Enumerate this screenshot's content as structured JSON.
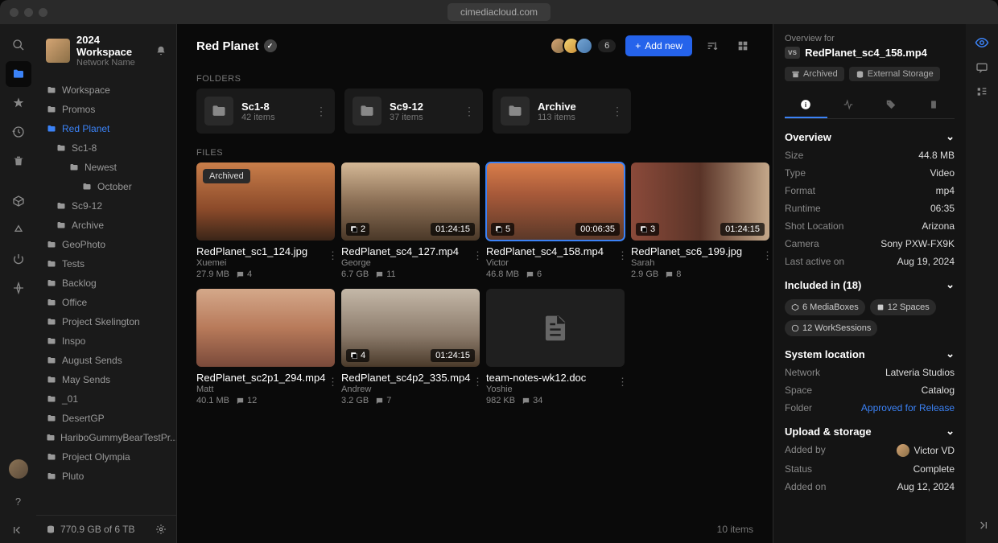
{
  "url": "cimediacloud.com",
  "workspace": {
    "title": "2024 Workspace",
    "subtitle": "Network Name"
  },
  "tree": [
    {
      "label": "Workspace",
      "icon": "folder",
      "indent": 0
    },
    {
      "label": "Promos",
      "icon": "folder",
      "indent": 0
    },
    {
      "label": "Red Planet",
      "icon": "folder-open",
      "indent": 0,
      "active": true
    },
    {
      "label": "Sc1-8",
      "icon": "folder",
      "indent": 1
    },
    {
      "label": "Newest",
      "icon": "folder",
      "indent": 2
    },
    {
      "label": "October",
      "icon": "folder",
      "indent": 3
    },
    {
      "label": "Sc9-12",
      "icon": "folder",
      "indent": 1
    },
    {
      "label": "Archive",
      "icon": "folder",
      "indent": 1
    },
    {
      "label": "GeoPhoto",
      "icon": "folder",
      "indent": 0
    },
    {
      "label": "Tests",
      "icon": "folder",
      "indent": 0
    },
    {
      "label": "Backlog",
      "icon": "folder",
      "indent": 0
    },
    {
      "label": "Office",
      "icon": "folder",
      "indent": 0
    },
    {
      "label": "Project Skelington",
      "icon": "folder",
      "indent": 0
    },
    {
      "label": "Inspo",
      "icon": "folder",
      "indent": 0
    },
    {
      "label": "August Sends",
      "icon": "folder",
      "indent": 0
    },
    {
      "label": "May Sends",
      "icon": "folder",
      "indent": 0
    },
    {
      "label": "_01",
      "icon": "folder",
      "indent": 0
    },
    {
      "label": "DesertGP",
      "icon": "folder",
      "indent": 0
    },
    {
      "label": "HariboGummyBearTestPr...",
      "icon": "folder",
      "indent": 0
    },
    {
      "label": "Project Olympia",
      "icon": "folder",
      "indent": 0
    },
    {
      "label": "Pluto",
      "icon": "folder",
      "indent": 0
    }
  ],
  "storage": "770.9 GB of 6 TB",
  "breadcrumb": "Red Planet",
  "avatar_count": "6",
  "add_btn": "Add new",
  "section_folders": "FOLDERS",
  "section_files": "FILES",
  "folders": [
    {
      "name": "Sc1-8",
      "count": "42 items"
    },
    {
      "name": "Sc9-12",
      "count": "37 items"
    },
    {
      "name": "Archive",
      "count": "113 items"
    }
  ],
  "files": [
    {
      "name": "RedPlanet_sc1_124.jpg",
      "author": "Xuemei",
      "size": "27.9 MB",
      "comments": "4",
      "archived": true,
      "t": "t1"
    },
    {
      "name": "RedPlanet_sc4_127.mp4",
      "author": "George",
      "size": "6.7 GB",
      "comments": "11",
      "bl": "2",
      "br": "01:24:15",
      "t": "t2"
    },
    {
      "name": "RedPlanet_sc4_158.mp4",
      "author": "Victor",
      "size": "46.8 MB",
      "comments": "6",
      "bl": "5",
      "br": "00:06:35",
      "selected": true,
      "t": "t3"
    },
    {
      "name": "RedPlanet_sc6_199.jpg",
      "author": "Sarah",
      "size": "2.9 GB",
      "comments": "8",
      "bl": "3",
      "br": "01:24:15",
      "t": "t4"
    },
    {
      "name": "RedPlanet_sc2p1_294.mp4",
      "author": "Matt",
      "size": "40.1 MB",
      "comments": "12",
      "t": "t5"
    },
    {
      "name": "RedPlanet_sc4p2_335.mp4",
      "author": "Andrew",
      "size": "3.2 GB",
      "comments": "7",
      "bl": "4",
      "br": "01:24:15",
      "t": "t6"
    },
    {
      "name": "team-notes-wk12.doc",
      "author": "Yoshie",
      "size": "982 KB",
      "comments": "34",
      "doc": true
    }
  ],
  "footer_count": "10 items",
  "archived_label": "Archived",
  "details": {
    "overview_for": "Overview for",
    "vs": "vs",
    "title": "RedPlanet_sc4_158.mp4",
    "badges": [
      {
        "icon": "archive",
        "label": "Archived"
      },
      {
        "icon": "storage",
        "label": "External Storage"
      }
    ],
    "overview_h": "Overview",
    "rows": [
      {
        "k": "Size",
        "v": "44.8 MB"
      },
      {
        "k": "Type",
        "v": "Video"
      },
      {
        "k": "Format",
        "v": "mp4"
      },
      {
        "k": "Runtime",
        "v": "06:35"
      },
      {
        "k": "Shot Location",
        "v": "Arizona"
      },
      {
        "k": "Camera",
        "v": "Sony PXW-FX9K"
      },
      {
        "k": "Last active on",
        "v": "Aug 19, 2024"
      }
    ],
    "included_h": "Included in (18)",
    "chips": [
      {
        "icon": "box",
        "label": "6 MediaBoxes"
      },
      {
        "icon": "space",
        "label": "12 Spaces"
      },
      {
        "icon": "session",
        "label": "12 WorkSessions"
      }
    ],
    "location_h": "System location",
    "loc_rows": [
      {
        "k": "Network",
        "v": "Latveria Studios"
      },
      {
        "k": "Space",
        "v": "Catalog"
      },
      {
        "k": "Folder",
        "v": "Approved for Release",
        "link": true
      }
    ],
    "upload_h": "Upload & storage",
    "up_rows": [
      {
        "k": "Added by",
        "v": "Victor VD",
        "avatar": true
      },
      {
        "k": "Status",
        "v": "Complete"
      },
      {
        "k": "Added on",
        "v": "Aug 12, 2024"
      }
    ]
  }
}
